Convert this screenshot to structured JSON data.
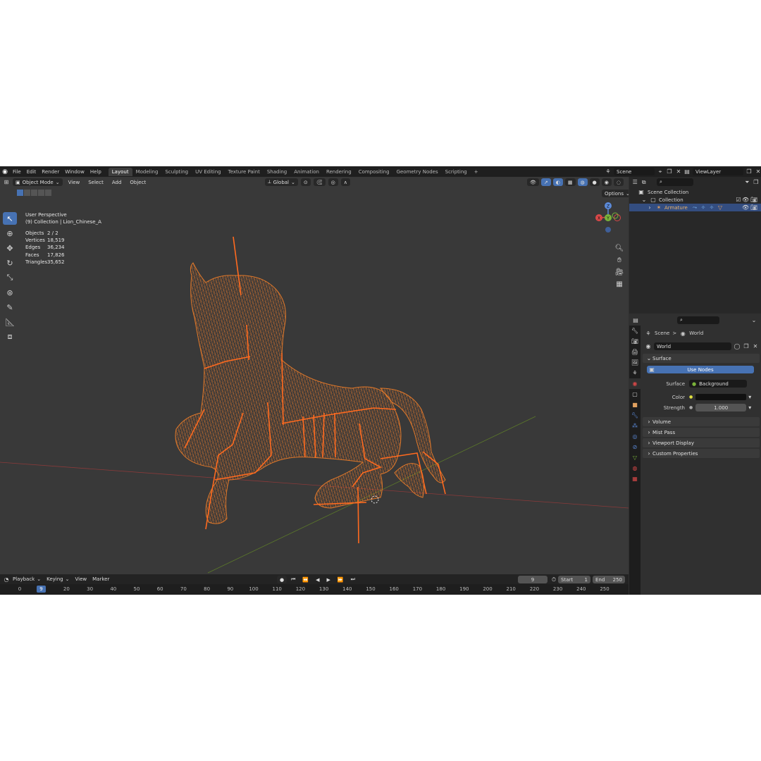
{
  "menu": {
    "items": [
      "File",
      "Edit",
      "Render",
      "Window",
      "Help"
    ]
  },
  "workspaces": {
    "tabs": [
      "Layout",
      "Modeling",
      "Sculpting",
      "UV Editing",
      "Texture Paint",
      "Shading",
      "Animation",
      "Rendering",
      "Compositing",
      "Geometry Nodes",
      "Scripting"
    ],
    "active": "Layout",
    "add_label": "+"
  },
  "scene": {
    "name": "Scene"
  },
  "view_layer": {
    "name": "ViewLayer"
  },
  "viewport_header": {
    "mode": "Object Mode",
    "menus": [
      "View",
      "Select",
      "Add",
      "Object"
    ],
    "orientation": "Global",
    "options_label": "Options"
  },
  "overlay": {
    "perspective": "User Perspective",
    "collection": "(9) Collection | Lion_Chinese_A"
  },
  "stats": [
    {
      "label": "Objects",
      "value": "2 / 2"
    },
    {
      "label": "Vertices",
      "value": "18,519"
    },
    {
      "label": "Edges",
      "value": "36,234"
    },
    {
      "label": "Faces",
      "value": "17,826"
    },
    {
      "label": "Triangles",
      "value": "35,652"
    }
  ],
  "gizmo": {
    "z": "Z",
    "y": "Y",
    "x": "X"
  },
  "outliner": {
    "root": "Scene Collection",
    "collection": "Collection",
    "object": "Armature"
  },
  "properties": {
    "breadcrumb_scene": "Scene",
    "breadcrumb_sep": ">",
    "breadcrumb_world": "World",
    "world_name": "World",
    "surface_panel": "Surface",
    "use_nodes": "Use Nodes",
    "surface_label": "Surface",
    "surface_value": "Background",
    "color_label": "Color",
    "strength_label": "Strength",
    "strength_value": "1.000",
    "panels": [
      "Volume",
      "Mist Pass",
      "Viewport Display",
      "Custom Properties"
    ]
  },
  "timeline": {
    "menus": [
      "Playback",
      "Keying",
      "View",
      "Marker"
    ],
    "current_frame": "9",
    "start_label": "Start",
    "start_value": "1",
    "end_label": "End",
    "end_value": "250",
    "ticks": [
      "0",
      "9",
      "20",
      "30",
      "40",
      "50",
      "60",
      "70",
      "80",
      "90",
      "100",
      "110",
      "120",
      "130",
      "140",
      "150",
      "160",
      "170",
      "180",
      "190",
      "200",
      "210",
      "220",
      "230",
      "240",
      "250"
    ]
  },
  "colors": {
    "accent": "#4772b3",
    "wire": "#e0782a",
    "bone": "#ff6a1f"
  }
}
